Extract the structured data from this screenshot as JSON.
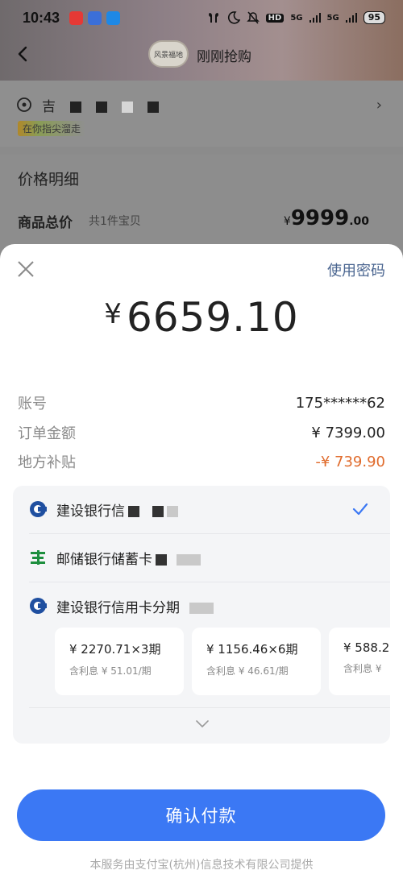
{
  "status_bar": {
    "time": "10:43",
    "network_1": "5G",
    "network_2": "5G",
    "hd": "HD",
    "battery": "95",
    "icons": [
      "app-icon-1",
      "app-icon-2",
      "app-icon-3",
      "earbuds-icon",
      "moon-icon",
      "mute-icon",
      "signal-icon",
      "battery-icon"
    ],
    "colors": {
      "app1": "#e53935",
      "app2": "#3b6fd8",
      "app3": "#1e88e5"
    }
  },
  "background_page": {
    "shop_name": "刚刚抢购",
    "shop_avatar_text": "风景福地",
    "address_prefix": "吉",
    "address_banner": "在你指尖溜走",
    "price_title": "价格明细",
    "goods_label": "商品总价",
    "goods_count": "共1件宝贝",
    "goods_price_currency": "¥",
    "goods_price_int": "9999",
    "goods_price_dec": ".00"
  },
  "sheet": {
    "password_link": "使用密码",
    "amount_currency": "¥",
    "amount_value": "6659.10",
    "details": [
      {
        "key": "账号",
        "value": "175******62"
      },
      {
        "key": "订单金额",
        "value": "¥ 7399.00"
      },
      {
        "key": "地方补贴",
        "value": "-¥ 739.90"
      }
    ],
    "methods": [
      {
        "label": "建设银行信",
        "icon": "ccb-bank-icon",
        "selected": true
      },
      {
        "label": "邮储银行储蓄卡",
        "icon": "psbc-bank-icon",
        "selected": false
      },
      {
        "label": "建设银行信用卡分期",
        "icon": "ccb-bank-icon",
        "selected": false
      }
    ],
    "installments": [
      {
        "main": "¥ 2270.71×3期",
        "sub": "含利息 ¥ 51.01/期"
      },
      {
        "main": "¥ 1156.46×6期",
        "sub": "含利息 ¥ 46.61/期"
      },
      {
        "main": "¥ 588.2",
        "sub": "含利息 ¥"
      }
    ],
    "confirm_label": "确认付款",
    "footer": "本服务由支付宝(杭州)信息技术有限公司提供",
    "colors": {
      "accent": "#3b78f4",
      "subsidy": "#e06b2c",
      "link": "#4a6590"
    }
  }
}
